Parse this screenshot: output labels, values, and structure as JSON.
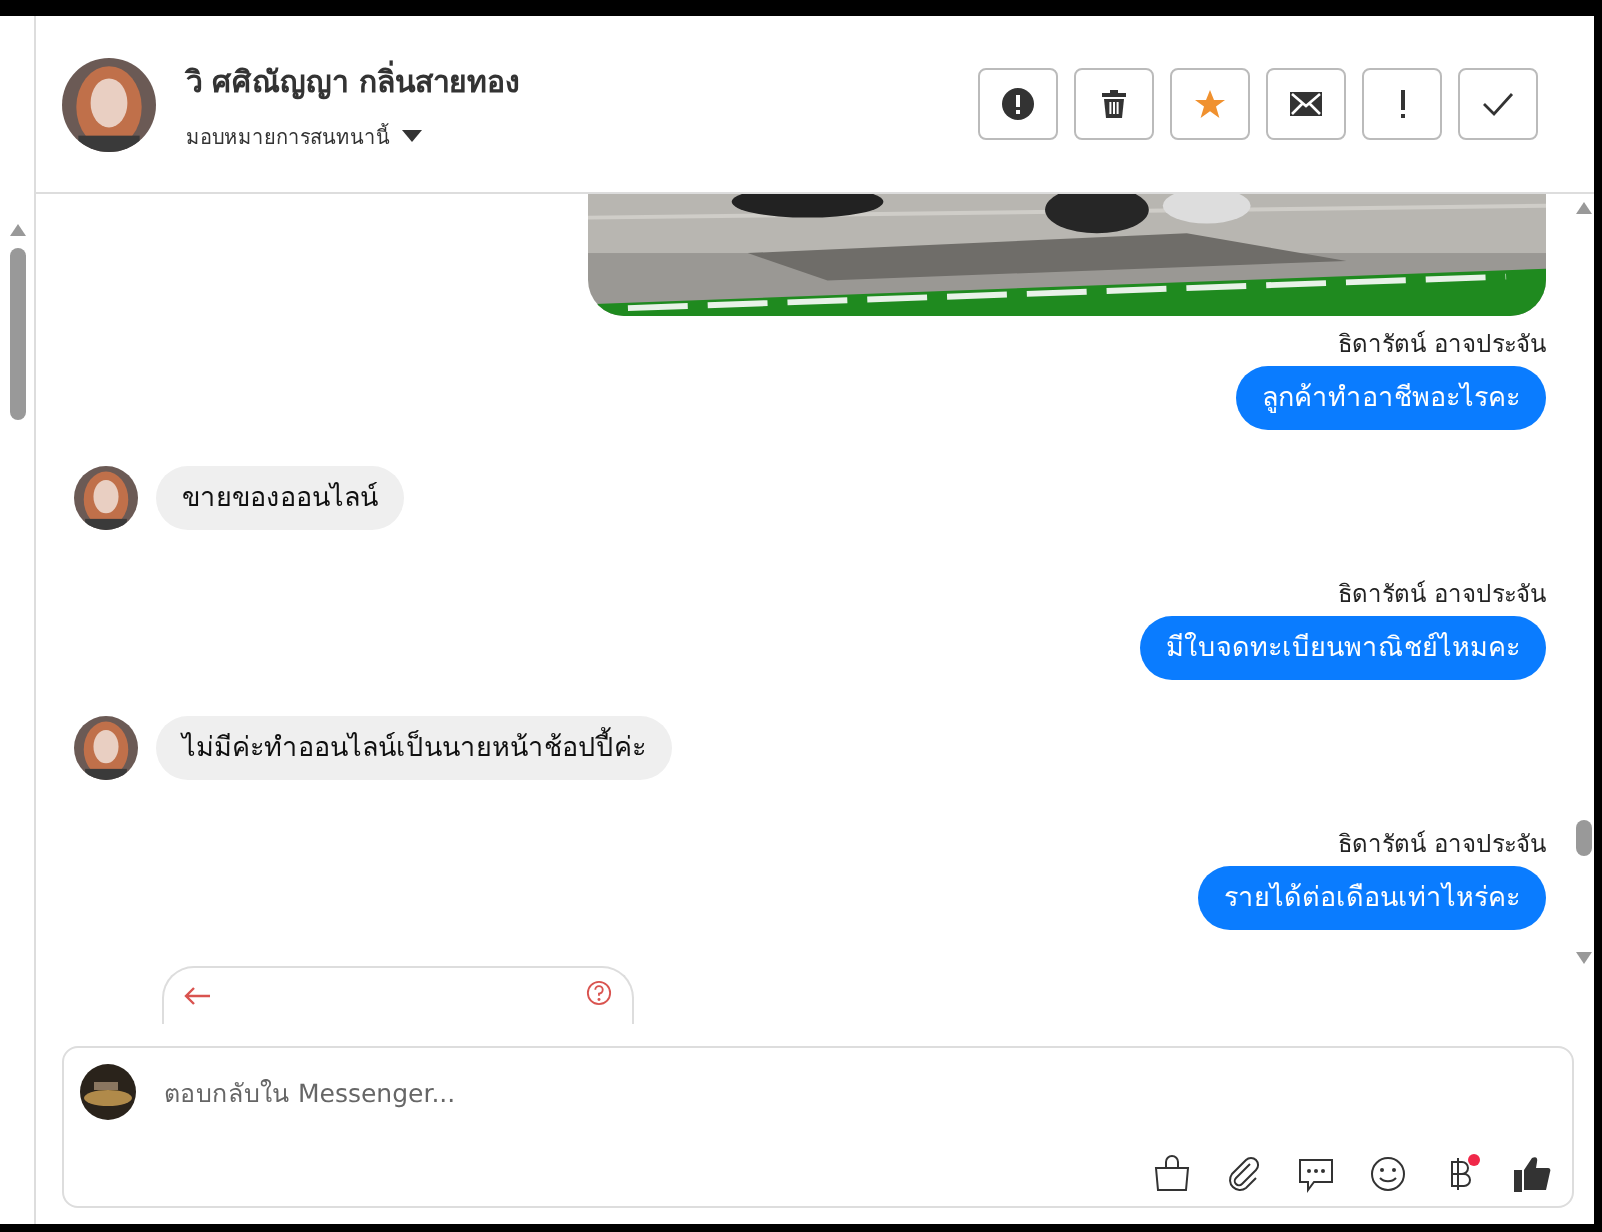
{
  "header": {
    "contact_name": "วิ ศศิณัญญา กลิ่นสายทอง",
    "assign_label": "มอบหมายการสนทนานี้",
    "actions": [
      {
        "kind": "spam"
      },
      {
        "kind": "delete"
      },
      {
        "kind": "star",
        "selected": true
      },
      {
        "kind": "unread"
      },
      {
        "kind": "important"
      },
      {
        "kind": "done"
      }
    ]
  },
  "messages": [
    {
      "kind": "picture"
    },
    {
      "kind": "outgoing",
      "sender": "ธิดารัตน์ อาจประจัน",
      "text": "ลูกค้าทำอาชีพอะไรคะ"
    },
    {
      "kind": "incoming",
      "text": "ขายของออนไลน์"
    },
    {
      "kind": "outgoing",
      "sender": "ธิดารัตน์ อาจประจัน",
      "text": "มีใบจดทะเบียนพาณิชย์ไหมคะ"
    },
    {
      "kind": "incoming",
      "text": "ไม่มีค่ะทำออนไลน์เป็นนายหน้าช้อปปี้ค่ะ"
    },
    {
      "kind": "outgoing",
      "sender": "ธิดารัตน์ อาจประจัน",
      "text": "รายได้ต่อเดือนเท่าไหร่คะ"
    },
    {
      "kind": "quick_reply"
    }
  ],
  "composer": {
    "placeholder": "ตอบกลับใน Messenger...",
    "tools": [
      {
        "kind": "shop"
      },
      {
        "kind": "attach"
      },
      {
        "kind": "saved"
      },
      {
        "kind": "emoji"
      },
      {
        "kind": "payment",
        "badge": true
      },
      {
        "kind": "like"
      }
    ]
  }
}
